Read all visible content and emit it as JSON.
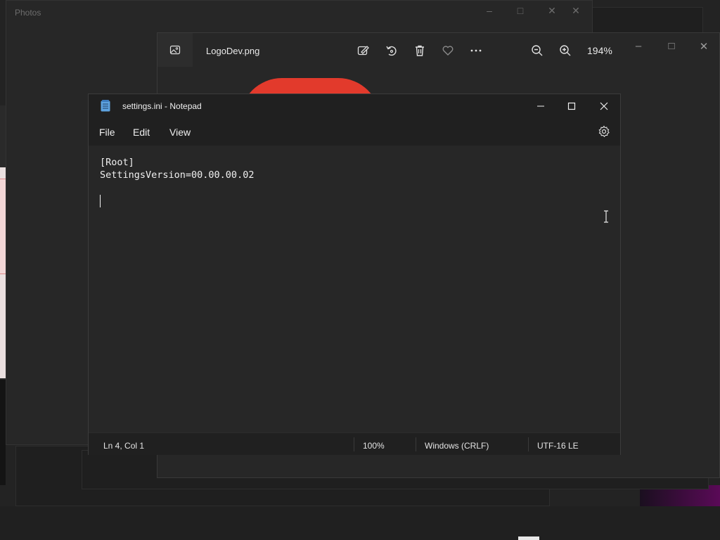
{
  "photos_back": {
    "title": "Photos"
  },
  "viewer": {
    "filename": "LogoDev.png",
    "zoom": "194%",
    "icons": [
      "image-icon",
      "edit-image-icon",
      "rotate-icon",
      "delete-icon",
      "favorite-icon",
      "more-icon",
      "zoom-out-icon",
      "zoom-in-icon"
    ]
  },
  "notepad": {
    "title": "settings.ini - Notepad",
    "menu": {
      "file": "File",
      "edit": "Edit",
      "view": "View"
    },
    "content": {
      "line1": "[Root]",
      "line2": "SettingsVersion=00.00.00.02",
      "line3": "",
      "line4": ""
    },
    "status": {
      "position": "Ln 4, Col 1",
      "zoom": "100%",
      "line_ending": "Windows (CRLF)",
      "encoding": "UTF-16 LE"
    }
  },
  "colors": {
    "accent_red": "#e23a2c",
    "notepad_icon": "#5ea3e0",
    "window_bg": "#272727",
    "titlebar_bg": "#202020"
  }
}
